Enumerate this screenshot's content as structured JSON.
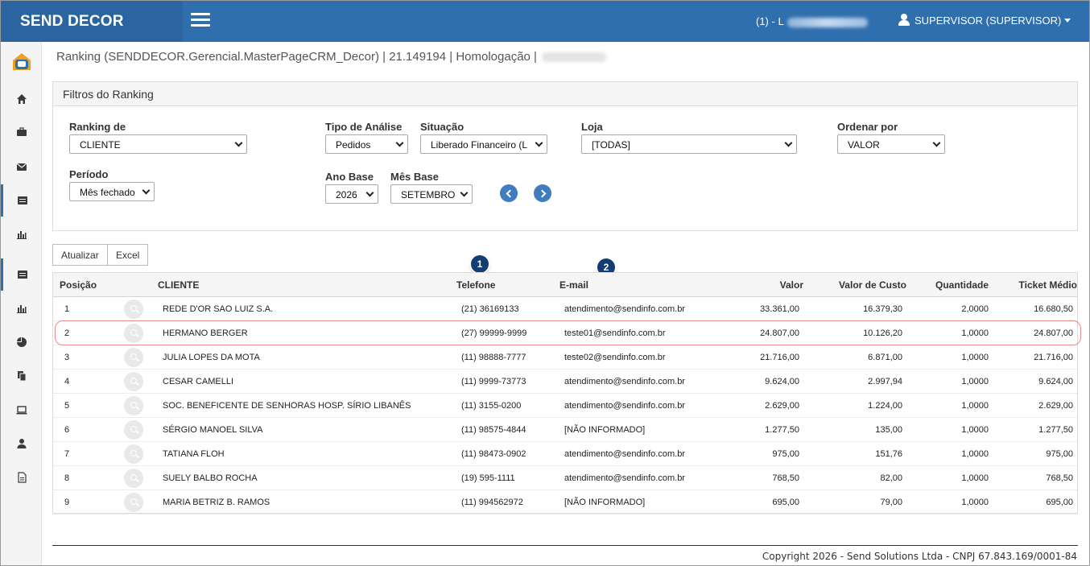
{
  "app": {
    "brand": "SEND DECOR",
    "store_info": "(1) - L",
    "user": "SUPERVISOR (SUPERVISOR)"
  },
  "breadcrumb": "Ranking (SENDDECOR.Gerencial.MasterPageCRM_Decor) | 21.149194 | Homologação |",
  "sidebar": {
    "icons": [
      "logo-icon",
      "home-icon",
      "briefcase-icon",
      "envelope-icon",
      "list-card-icon",
      "bar-chart-icon",
      "list-card-icon",
      "bar-chart-icon",
      "pie-chart-icon",
      "copy-icon",
      "laptop-icon",
      "user-icon",
      "file-icon"
    ]
  },
  "filters": {
    "title": "Filtros do Ranking",
    "ranking_de": {
      "label": "Ranking de",
      "value": "CLIENTE"
    },
    "tipo_analise": {
      "label": "Tipo de Análise",
      "value": "Pedidos"
    },
    "situacao": {
      "label": "Situação",
      "value": "Liberado Financeiro (L"
    },
    "loja": {
      "label": "Loja",
      "value": "[TODAS]"
    },
    "ordenar_por": {
      "label": "Ordenar por",
      "value": "VALOR"
    },
    "periodo": {
      "label": "Período",
      "value": "Mês fechado"
    },
    "ano_base": {
      "label": "Ano Base",
      "value": "2026"
    },
    "mes_base": {
      "label": "Mês Base",
      "value": "SETEMBRO"
    }
  },
  "toolbar": {
    "update_label": "Atualizar",
    "excel_label": "Excel"
  },
  "badges": [
    "1",
    "2"
  ],
  "table": {
    "headers": [
      "Posição",
      "CLIENTE",
      "Telefone",
      "E-mail",
      "Valor",
      "Valor de Custo",
      "Quantidade",
      "Ticket Médio"
    ],
    "rows": [
      {
        "pos": "1",
        "cliente": "REDE D'OR SAO LUIZ S.A.",
        "telefone": "(21) 36169133",
        "email": "atendimento@sendinfo.com.br",
        "valor": "33.361,00",
        "custo": "16.379,30",
        "qtd": "2,0000",
        "ticket": "16.680,50"
      },
      {
        "pos": "2",
        "cliente": "HERMANO BERGER",
        "telefone": "(27) 99999-9999",
        "email": "teste01@sendinfo.com.br",
        "valor": "24.807,00",
        "custo": "10.126,20",
        "qtd": "1,0000",
        "ticket": "24.807,00"
      },
      {
        "pos": "3",
        "cliente": "JULIA LOPES DA MOTA",
        "telefone": "(11) 98888-7777",
        "email": "teste02@sendinfo.com.br",
        "valor": "21.716,00",
        "custo": "6.871,00",
        "qtd": "1,0000",
        "ticket": "21.716,00"
      },
      {
        "pos": "4",
        "cliente": "CESAR CAMELLI",
        "telefone": "(11) 9999-73773",
        "email": "atendimento@sendinfo.com.br",
        "valor": "9.624,00",
        "custo": "2.997,94",
        "qtd": "1,0000",
        "ticket": "9.624,00"
      },
      {
        "pos": "5",
        "cliente": "SOC. BENEFICENTE DE SENHORAS HOSP. SÍRIO LIBANÊS",
        "telefone": "(11) 3155-0200",
        "email": "atendimento@sendinfo.com.br",
        "valor": "2.629,00",
        "custo": "1.224,00",
        "qtd": "1,0000",
        "ticket": "2.629,00"
      },
      {
        "pos": "6",
        "cliente": "SÉRGIO MANOEL SILVA",
        "telefone": "(11) 98575-4844",
        "email": "[NÃO INFORMADO]",
        "valor": "1.277,50",
        "custo": "135,00",
        "qtd": "1,0000",
        "ticket": "1.277,50"
      },
      {
        "pos": "7",
        "cliente": "TATIANA FLOH",
        "telefone": "(11) 98473-0902",
        "email": "atendimento@sendinfo.com.br",
        "valor": "975,00",
        "custo": "151,76",
        "qtd": "1,0000",
        "ticket": "975,00"
      },
      {
        "pos": "8",
        "cliente": "SUELY BALBO ROCHA",
        "telefone": "(19) 595-1111",
        "email": "atendimento@sendinfo.com.br",
        "valor": "768,50",
        "custo": "82,00",
        "qtd": "1,0000",
        "ticket": "768,50"
      },
      {
        "pos": "9",
        "cliente": "MARIA BETRIZ B. RAMOS",
        "telefone": "(11) 994562972",
        "email": "[NÃO INFORMADO]",
        "valor": "695,00",
        "custo": "79,00",
        "qtd": "1,0000",
        "ticket": "695,00"
      }
    ]
  },
  "footer": {
    "copyright": "Copyright 2026 - Send Solutions Ltda - CNPJ 67.843.169/0001-84"
  },
  "colors": {
    "topbar": "#2f6fae",
    "brand_bg": "#2a65a1",
    "badge": "#123e74",
    "highlight": "#e88b8b"
  }
}
